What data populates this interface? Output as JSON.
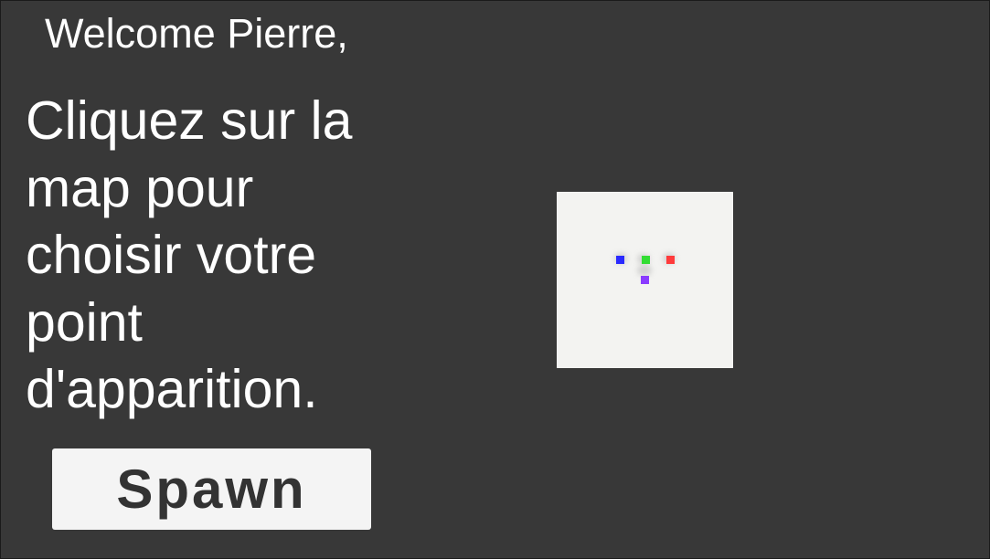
{
  "welcome_text": "Welcome Pierre,",
  "instructions": "Cliquez sur la map pour choisir votre point d'apparition.",
  "spawn_button": {
    "label": "Spawn"
  },
  "map": {
    "markers": [
      {
        "name": "blue",
        "color": "#2a2aff"
      },
      {
        "name": "green",
        "color": "#33dd33"
      },
      {
        "name": "red",
        "color": "#ff3b3b"
      },
      {
        "name": "purple",
        "color": "#8a3bff"
      }
    ]
  },
  "colors": {
    "background": "#383838",
    "text": "#ffffff",
    "button_background": "#f4f4f4",
    "button_text": "#333333",
    "map_background": "#f3f3f1"
  }
}
